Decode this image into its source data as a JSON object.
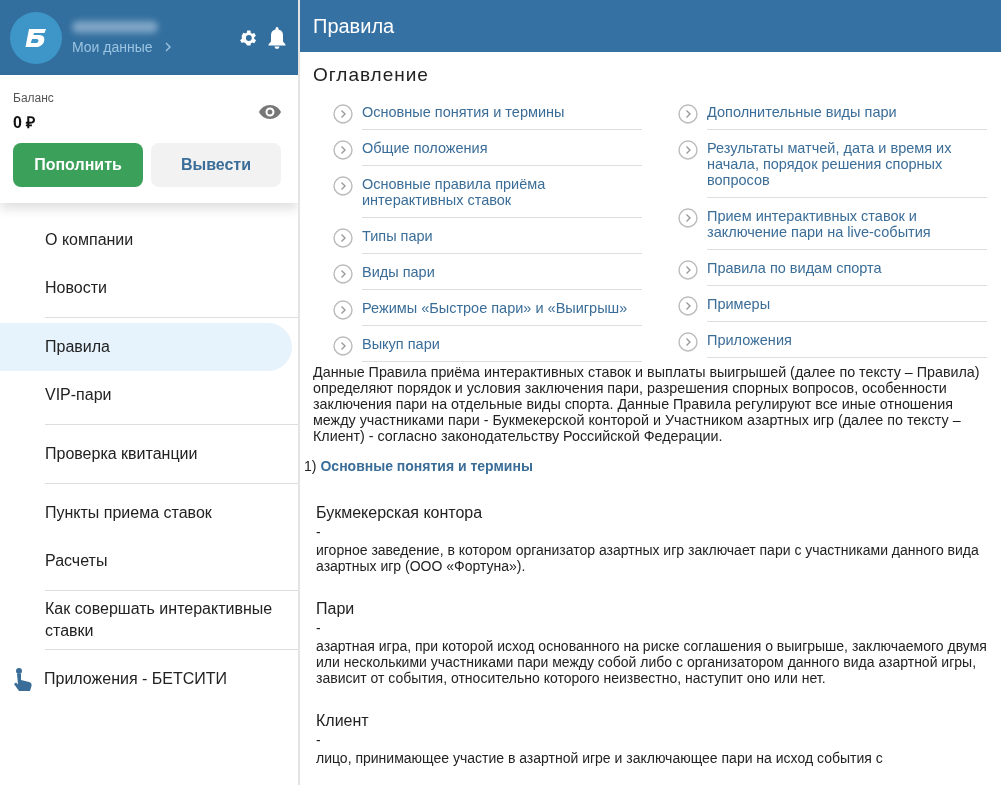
{
  "profile": {
    "link": "Мои данные"
  },
  "balance": {
    "label": "Баланс",
    "amount": "0 ₽",
    "buttons": [
      {
        "label": "Пополнить",
        "kind": "primary"
      },
      {
        "label": "Вывести",
        "kind": "secondary"
      }
    ]
  },
  "sidebar": {
    "groups": [
      [
        {
          "label": "О компании",
          "selected": false,
          "kind": "link"
        },
        {
          "label": "Новости",
          "selected": false,
          "kind": "link"
        }
      ],
      [
        {
          "label": "Правила",
          "selected": true,
          "kind": "link"
        },
        {
          "label": "VIP-пари",
          "selected": false,
          "kind": "link"
        }
      ],
      [
        {
          "label": "Проверка квитанции",
          "selected": false,
          "kind": "link"
        }
      ],
      [
        {
          "label": "Пункты приема ставок",
          "selected": false,
          "kind": "link"
        },
        {
          "label": "Расчеты",
          "selected": false,
          "kind": "link"
        }
      ],
      [
        {
          "label": "Как совершать интерактивные ставки",
          "selected": false,
          "kind": "link"
        }
      ],
      [
        {
          "label": "Приложения - БЕТСИТИ",
          "selected": false,
          "kind": "app"
        }
      ]
    ]
  },
  "page": {
    "title": "Правила",
    "toc_title": "Оглавление",
    "toc_columns": [
      [
        "Основные понятия и термины",
        "Общие положения",
        "Основные правила приёма интерактивных ставок",
        "Типы пари",
        "Виды пари",
        "Режимы «Быстрое пари» и «Выигрыш»",
        "Выкуп пари"
      ],
      [
        "Дополнительные виды пари",
        "Результаты матчей, дата и время их начала, порядок решения спорных вопросов",
        "Прием интерактивных ставок и заключение пари на live-события",
        "Правила по видам спорта",
        "Примеры",
        "Приложения"
      ]
    ],
    "intro": "Данные Правила приёма интерактивных ставок и выплаты выигрышей (далее по тексту – Правила) определяют порядок и условия заключения пари, разрешения спорных вопросов, особенности заключения пари на отдельные виды спорта. Данные Правила регулируют все иные отношения между участниками пари - Букмекерской конторой и Участником азартных игр (далее по тексту – Клиент) - согласно законодательству Российской Федерации.",
    "section": {
      "number": "1)",
      "title": "Основные понятия и термины"
    },
    "terms": [
      {
        "term": "Букмекерская контора",
        "dash": "-",
        "definition": "игорное заведение, в котором организатор азартных игр заключает пари с участниками данного вида азартных игр (ООО «Фортуна»)."
      },
      {
        "term": "Пари",
        "dash": "-",
        "definition": "азартная игра, при которой исход основанного на риске соглашения о выигрыше, заключаемого двумя или несколькими участниками пари между собой либо с организатором данного вида азартной игры, зависит от события, относительно которого неизвестно, наступит оно или нет."
      },
      {
        "term": "Клиент",
        "dash": "-",
        "definition": "лицо, принимающее участие в азартной игре и заключающее пари на исход события с"
      }
    ]
  }
}
